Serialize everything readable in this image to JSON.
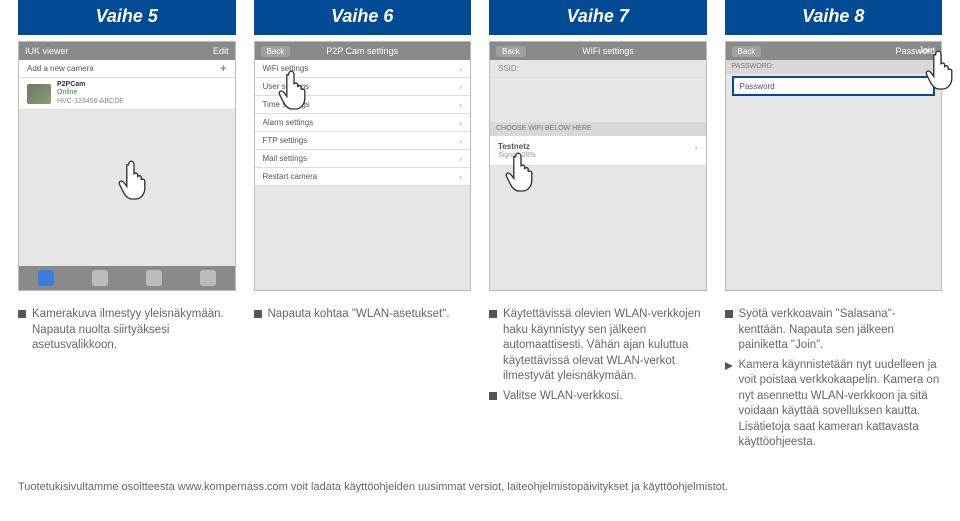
{
  "steps": {
    "s5": "Vaihe 5",
    "s6": "Vaihe 6",
    "s7": "Vaihe 7",
    "s8": "Vaihe 8"
  },
  "screen5": {
    "topbar_left": "IUK viewer",
    "topbar_right": "Edit",
    "add_row": "Add a new camera",
    "cam_name": "P2PCam",
    "cam_status": "Online",
    "cam_id": "HVC-123456-ABCDE"
  },
  "screen6": {
    "back": "Back",
    "title": "P2P Cam settings",
    "items": [
      "WiFi settings",
      "User settings",
      "Time settings",
      "Alarm settings",
      "FTP settings",
      "Mail settings",
      "Restart camera"
    ]
  },
  "screen7": {
    "back": "Back",
    "title": "WiFi settings",
    "ssid_label": "SSID:",
    "section": "CHOOSE WIFI BELOW HERE",
    "net_name": "Testnetz",
    "net_signal": "Signal:-28%"
  },
  "screen8": {
    "back": "Back",
    "title": "Password",
    "join": "Join",
    "pw_section": "PASSWORD:",
    "pw_field": "Password"
  },
  "bullets": {
    "c5_a": "Kamerakuva ilmestyy yleisnäkymään. Napauta nuolta siirtyäksesi asetusvalikkoon.",
    "c6_a": "Napauta kohtaa \"WLAN-asetukset\".",
    "c7_a": "Käytettävissä olevien WLAN-verkkojen haku käynnistyy sen jälkeen automaattisesti. Vähän ajan kuluttua käytettävissä olevat WLAN-verkot ilmestyvät yleisnäkymään.",
    "c7_b": "Valitse WLAN-verkkosi.",
    "c8_a": "Syötä verkkoavain \"Salasana\"-kenttään. Napauta sen jälkeen painiketta \"Join\".",
    "c8_b": "Kamera käynnistetään nyt uudelleen ja voit poistaa verkkokaapelin. Kamera on nyt asennettu WLAN-verkkoon ja sitä voidaan käyttää sovelluksen kautta. Lisätietoja saat kameran kattavasta käyttöohjeesta."
  },
  "footer": "Tuotetukisivultamme osoitteesta www.kompernass.com voit ladata käyttöohjeiden uusimmat versiot, laiteohjelmistopäivitykset ja käyttöohjelmistot."
}
